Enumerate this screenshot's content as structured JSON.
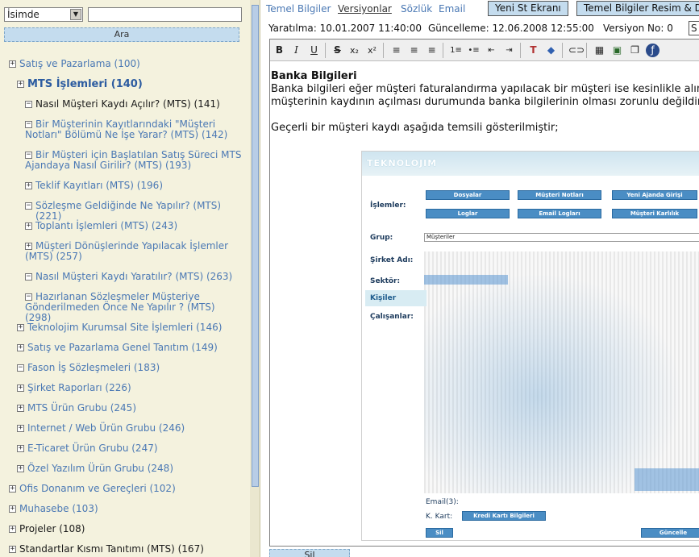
{
  "search": {
    "field": "İsimde",
    "query": "",
    "button": "Ara"
  },
  "tree": [
    {
      "label": "Satış ve Pazarlama (100)",
      "box": "+",
      "style": "blue"
    },
    {
      "label": "MTS İşlemleri (140)",
      "box": "+",
      "style": "bold"
    },
    {
      "label": "Nasıl Müşteri Kaydı Açılır? (MTS) (141)",
      "box": "−",
      "style": "dark"
    },
    {
      "label": "Bir Müşterinin Kayıtlarındaki \"Müşteri Notları\" Bölümü Ne İşe Yarar? (MTS) (142)",
      "box": "−",
      "style": "blue"
    },
    {
      "label": "Bir Müşteri için Başlatılan Satış Süreci MTS Ajandaya Nasıl Girilir? (MTS) (193)",
      "box": "−",
      "style": "blue"
    },
    {
      "label": "Teklif Kayıtları (MTS) (196)",
      "box": "+",
      "style": "blue"
    },
    {
      "label": "Sözleşme Geldiğinde Ne Yapılır? (MTS) (221)",
      "box": "−",
      "style": "blue"
    },
    {
      "label": "Toplantı İşlemleri (MTS) (243)",
      "box": "+",
      "style": "blue"
    },
    {
      "label": "Müşteri Dönüşlerinde Yapılacak İşlemler (MTS) (257)",
      "box": "+",
      "style": "blue"
    },
    {
      "label": "Nasıl Müşteri Kaydı Yaratılır? (MTS) (263)",
      "box": "−",
      "style": "blue"
    },
    {
      "label": "Hazırlanan Sözleşmeler Müşteriye Gönderilmeden Önce Ne Yapılır ? (MTS) (298)",
      "box": "−",
      "style": "blue"
    },
    {
      "label": "Teknolojim Kurumsal Site İşlemleri (146)",
      "box": "+",
      "style": "blue"
    },
    {
      "label": "Satış ve Pazarlama Genel Tanıtım (149)",
      "box": "+",
      "style": "blue"
    },
    {
      "label": "Fason İş Sözleşmeleri (183)",
      "box": "−",
      "style": "blue"
    },
    {
      "label": "Şirket Raporları (226)",
      "box": "+",
      "style": "blue"
    },
    {
      "label": "MTS Ürün Grubu (245)",
      "box": "+",
      "style": "blue"
    },
    {
      "label": "Internet / Web Ürün Grubu (246)",
      "box": "+",
      "style": "blue"
    },
    {
      "label": "E-Ticaret Ürün Grubu (247)",
      "box": "+",
      "style": "blue"
    },
    {
      "label": "Özel Yazılım Ürün Grubu (248)",
      "box": "+",
      "style": "blue"
    },
    {
      "label": "Ofis Donanım ve Gereçleri (102)",
      "box": "+",
      "style": "blue"
    },
    {
      "label": "Muhasebe (103)",
      "box": "+",
      "style": "blue"
    },
    {
      "label": "Projeler (108)",
      "box": "+",
      "style": "dark"
    },
    {
      "label": "Standartlar Kısmı Tanıtımı (MTS) (167)",
      "box": "+",
      "style": "dark"
    }
  ],
  "tabs": {
    "t1": "Temel Bilgiler",
    "t2": "Versiyonlar",
    "t3": "Sözlük",
    "t4": "Email",
    "btn1": "Yeni St Ekranı",
    "btn2": "Temel Bilgiler Resim & Dosya"
  },
  "meta": {
    "created": "Yaratılma: 10.01.2007 11:40:00",
    "updated": "Güncelleme: 12.06.2008 12:55:00",
    "version": "Versiyon No: 0",
    "box": "S"
  },
  "content": {
    "heading": "Banka Bilgileri",
    "line1": "Banka bilgileri eğer müşteri faturalandırma yapılacak bir müşteri ise kesinlikle alınmalı",
    "line2": "müşterinin kaydının açılması durumunda banka bilgilerinin olması zorunlu değildir.",
    "line3": "Geçerli bir müşteri kaydı aşağıda temsili gösterilmiştir;"
  },
  "shot": {
    "logo": "TEKNOLOJIM",
    "islemler": "İşlemler:",
    "btn_dosyalar": "Dosyalar",
    "btn_notlari": "Müşteri Notları",
    "btn_ajanda": "Yeni Ajanda Girişi",
    "btn_loglar": "Loglar",
    "btn_email": "Email Logları",
    "btn_karlilik": "Müşteri Karlılık",
    "grup": "Grup:",
    "grup_value": "Müşteriler",
    "sirket": "Şirket Adı:",
    "sektor": "Sektör:",
    "kisiler": "Kişiler",
    "calisanlar": "Çalışanlar:",
    "email3": "Email(3):",
    "kkart": "K. Kart:",
    "kkart_btn": "Kredi Kartı Bilgileri",
    "sil": "Sil",
    "guncelle": "Güncelle"
  },
  "bottom": {
    "button": "Sil"
  }
}
